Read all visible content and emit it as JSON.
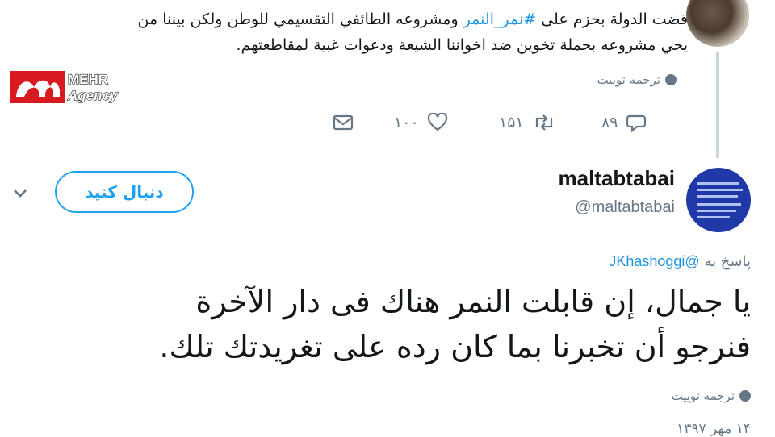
{
  "top_tweet": {
    "line1_prefix": "قضت الدولة بحزم على ",
    "line1_hashtag": "#نمر_النمر",
    "line1_suffix": " ومشروعه الطائفي التقسيمي للوطن ولكن بيننا من",
    "line2": "يحي مشروعه بحملة تخوين ضد اخواننا الشيعة ودعوات غبية لمقاطعتهم.",
    "translate_label": "ترجمه توییت",
    "actions": {
      "replies": "۸۹",
      "retweets": "۱۵۱",
      "likes": "۱۰۰"
    }
  },
  "watermark": {
    "line1": "MEHR",
    "line2": "Agency",
    "brand_color": "#d71920"
  },
  "tweet": {
    "display_name": "maltabtabai",
    "handle": "@maltabtabai",
    "follow_label": "دنبال کنید",
    "reply_prefix": "پاسخ به",
    "reply_mention": "@JKhashoggi",
    "line1": "يا جمال، إن قابلت النمر هناك فى دار الآخرة",
    "line2": "فنرجو أن تخبرنا بما كان رده على تغريدتك تلك.",
    "translate_label": "ترجمه توییت",
    "date_partial": "۱۴ مهر ۱۳۹۷"
  },
  "colors": {
    "accent": "#1da1f2",
    "link": "#1b95e0",
    "muted": "#657786",
    "divider": "#ccd6dd"
  },
  "icons": [
    "globe-icon",
    "reply-icon",
    "retweet-icon",
    "like-icon",
    "message-icon",
    "chevron-down-icon"
  ]
}
